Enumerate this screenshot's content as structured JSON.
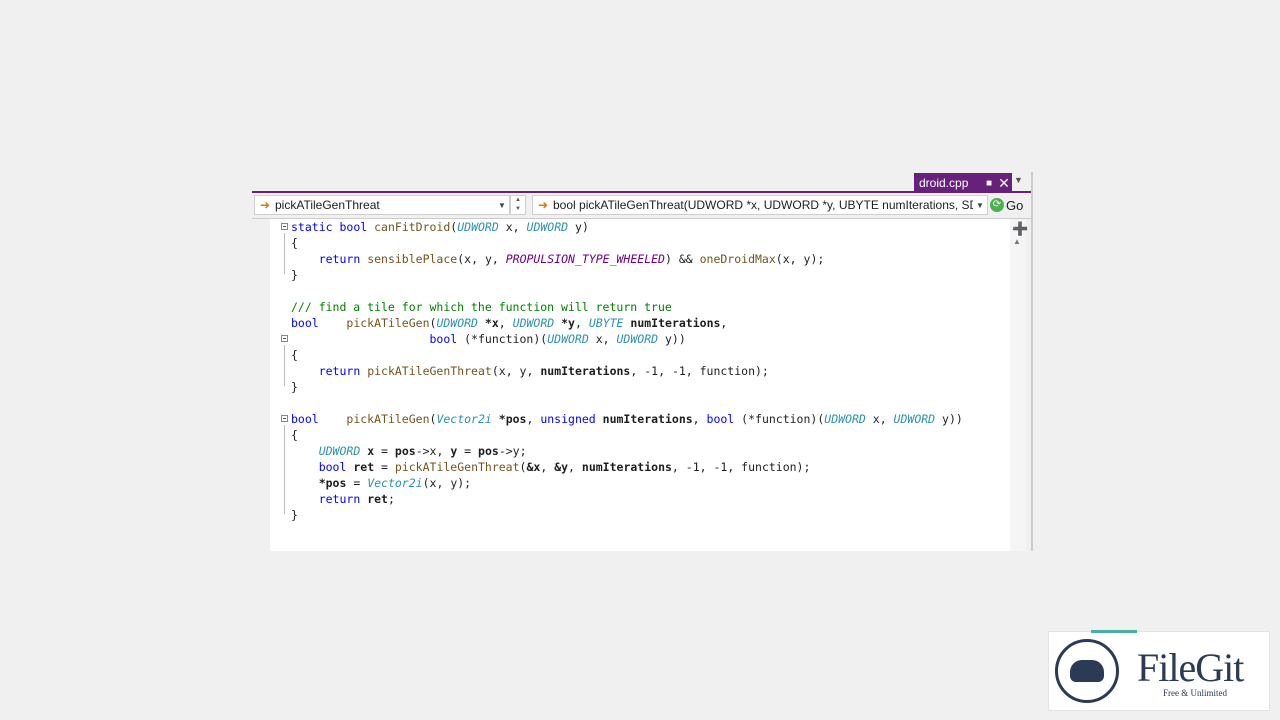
{
  "tab": {
    "filename": "droid.cpp"
  },
  "navbar": {
    "scope": "pickATileGenThreat",
    "member": "bool pickATileGenThreat(UDWORD *x, UDWORD *y, UBYTE numIterations, SDW",
    "go_label": "Go"
  },
  "icons": {
    "pin": "pin-icon",
    "close": "close-icon",
    "go": "go-icon",
    "split": "split-window-icon",
    "scroll_up": "scroll-up-icon"
  },
  "code": {
    "l1": [
      "static",
      "bool",
      "canFitDroid",
      "UDWORD",
      "x",
      "UDWORD",
      "y"
    ],
    "l3": [
      "return",
      "sensiblePlace",
      "x",
      "y",
      "PROPULSION_TYPE_WHEELED",
      "oneDroidMax",
      "x",
      "y"
    ],
    "l6": "/// find a tile for which the function will return true",
    "l7": [
      "bool",
      "pickATileGen",
      "UDWORD",
      "*x",
      "UDWORD",
      "*y",
      "UBYTE",
      "numIterations"
    ],
    "l8": [
      "bool",
      "(*function)(",
      "UDWORD",
      "x",
      "UDWORD",
      "y))"
    ],
    "l10": [
      "return",
      "pickATileGenThreat",
      "x",
      "y",
      "numIterations",
      "-1, -1, function);"
    ],
    "l13": [
      "bool",
      "pickATileGen",
      "Vector2i",
      "*pos",
      "unsigned",
      "numIterations",
      "bool",
      "(*function)(",
      "UDWORD",
      "x",
      "UDWORD",
      "y))"
    ],
    "l15": [
      "UDWORD",
      "x",
      "pos",
      "->x, ",
      "y",
      "pos",
      "->y;"
    ],
    "l16": [
      "bool",
      "ret",
      "pickATileGenThreat",
      "&x",
      "&y",
      "numIterations",
      "-1, -1, function);"
    ],
    "l17": [
      "*pos",
      "Vector2i",
      "x",
      "y"
    ],
    "l18": [
      "return",
      "ret"
    ]
  },
  "watermark": {
    "brand": "FileGit",
    "tagline": "Free & Unlimited"
  },
  "colors": {
    "accent": "#68217a",
    "keyword": "#0000ff",
    "type": "#2b91af",
    "comment": "#008000",
    "macro": "#6f008a",
    "function": "#74531f"
  }
}
